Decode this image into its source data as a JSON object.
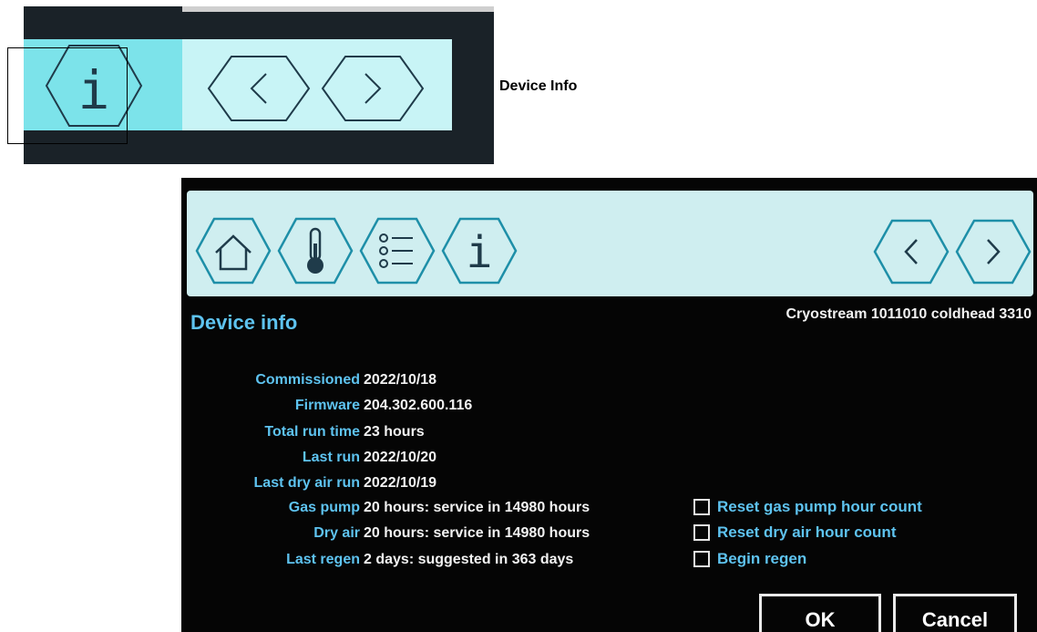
{
  "inset": {
    "icons": [
      "info-icon",
      "chevron-left-icon",
      "chevron-right-icon"
    ],
    "info_glyph": "i",
    "prev_glyph": "<",
    "next_glyph": ">",
    "caption": "Device Info",
    "colors": {
      "highlight": "#7ce3ea",
      "toolbar": "#c8f4f6"
    }
  },
  "screen": {
    "toolbar": {
      "icons": [
        "home-icon",
        "thermometer-icon",
        "list-icon",
        "info-icon",
        "chevron-left-icon",
        "chevron-right-icon"
      ],
      "info_glyph": "i"
    },
    "title": "Device info",
    "device_id": "Cryostream 1011010 coldhead 3310",
    "rows": [
      {
        "label": "Commissioned",
        "value": "2022/10/18"
      },
      {
        "label": "Firmware",
        "value": "204.302.600.116"
      },
      {
        "label": "Total run time",
        "value": "23 hours"
      },
      {
        "label": "Last run",
        "value": "2022/10/20"
      },
      {
        "label": "Last dry air run",
        "value": "2022/10/19"
      },
      {
        "label": "Gas pump",
        "value": "20 hours: service in 14980 hours"
      },
      {
        "label": "Dry air",
        "value": "20 hours: service in 14980 hours"
      },
      {
        "label": "Last regen",
        "value": "2 days: suggested in 363 days"
      }
    ],
    "checkboxes": [
      {
        "label": "Reset gas pump hour count",
        "checked": false
      },
      {
        "label": "Reset dry air hour count",
        "checked": false
      },
      {
        "label": "Begin regen",
        "checked": false
      }
    ],
    "ok_label": "OK",
    "cancel_label": "Cancel",
    "colors": {
      "label": "#5ec3f0",
      "value": "#f2f2f2",
      "background": "#050505",
      "toolbar": "#cfeef0"
    }
  }
}
